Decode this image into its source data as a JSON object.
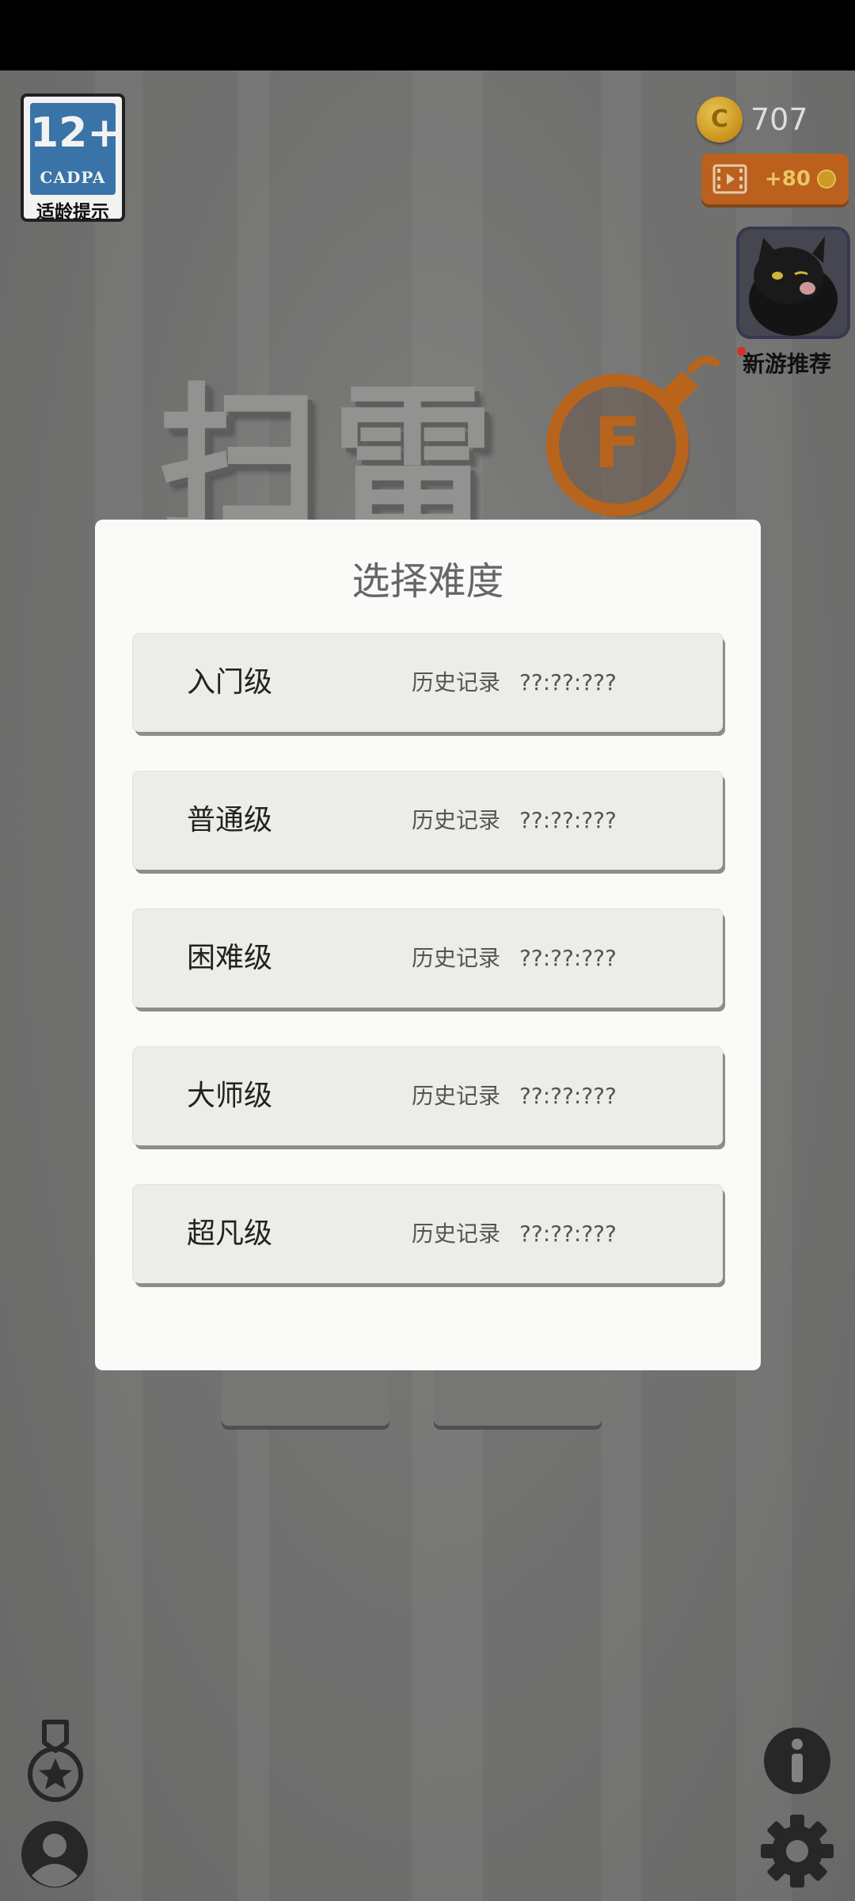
{
  "status_bar": {},
  "age_badge": {
    "rating": "12+",
    "org": "CADPA",
    "caption": "适龄提示"
  },
  "currency": {
    "coins": "707",
    "coin_symbol": "C",
    "video_reward": "+80"
  },
  "new_game": {
    "label": "新游推荐"
  },
  "game_title": {
    "text": "扫雷",
    "logo_letter": "F"
  },
  "dialog": {
    "title": "选择难度",
    "levels": [
      {
        "name": "入门级",
        "history_label": "历史记录",
        "record": "??:??:???"
      },
      {
        "name": "普通级",
        "history_label": "历史记录",
        "record": "??:??:???"
      },
      {
        "name": "困难级",
        "history_label": "历史记录",
        "record": "??:??:???"
      },
      {
        "name": "大师级",
        "history_label": "历史记录",
        "record": "??:??:???"
      },
      {
        "name": "超凡级",
        "history_label": "历史记录",
        "record": "??:??:???"
      }
    ]
  },
  "icons": {
    "medal": "medal-icon",
    "profile": "profile-icon",
    "info": "info-icon",
    "settings": "gear-icon"
  },
  "colors": {
    "accent_orange": "#c6661f",
    "dialog_bg": "#fafaf8",
    "button_bg": "#ecece9",
    "badge_blue": "#3d7ab0"
  }
}
